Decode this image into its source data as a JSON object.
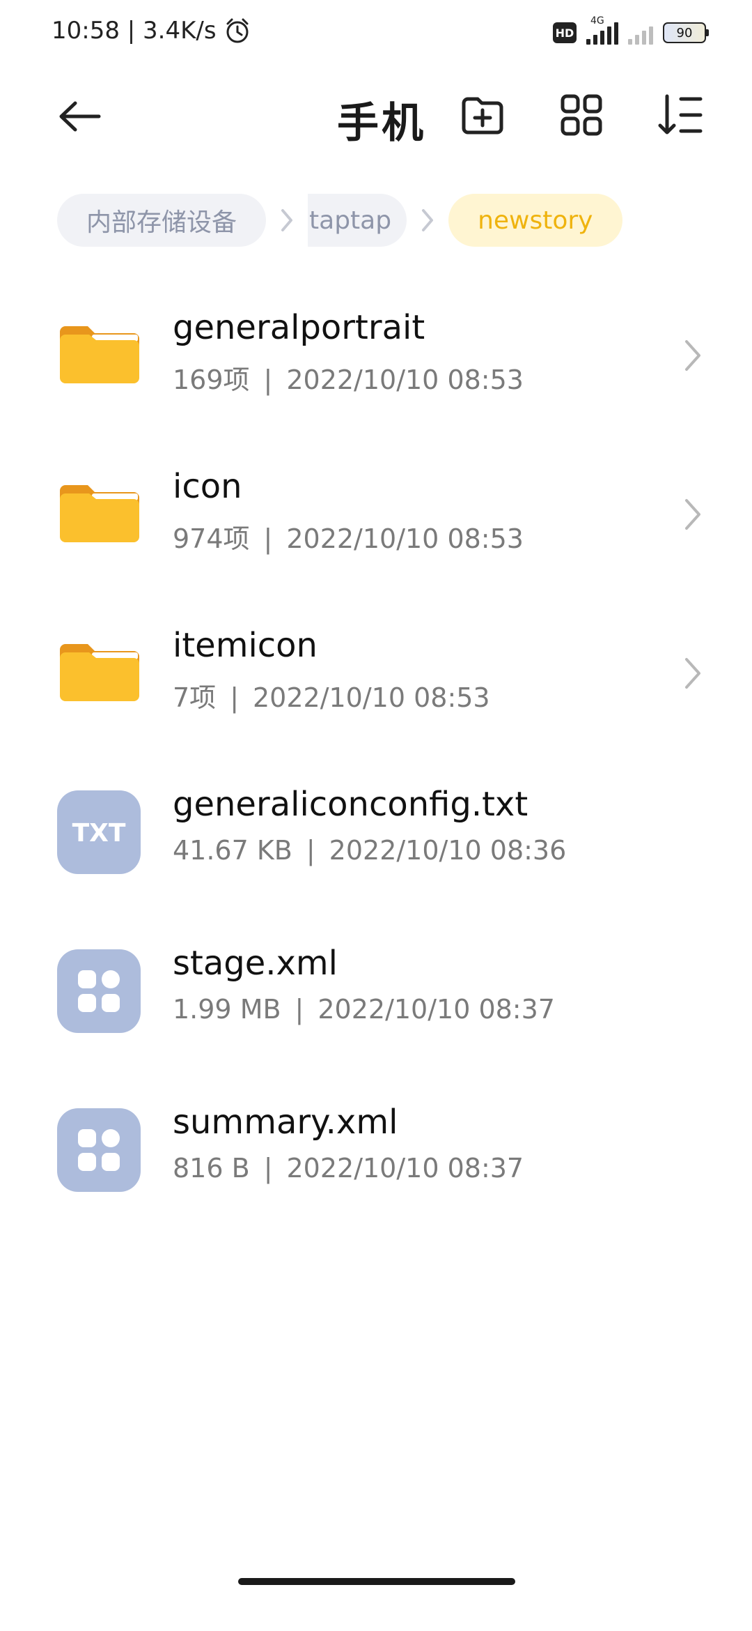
{
  "status_bar": {
    "time_speed": "10:58 | 3.4K/s",
    "hd_label": "HD",
    "network_label": "4G",
    "battery": "90"
  },
  "toolbar": {
    "title": "手机"
  },
  "breadcrumb": [
    {
      "label": "内部存储设备"
    },
    {
      "label": "taptap"
    },
    {
      "label": "newstory"
    }
  ],
  "files": [
    {
      "name": "generalportrait",
      "meta_left": "169项",
      "meta_right": "2022/10/10 08:53",
      "icon": "folder-icon"
    },
    {
      "name": "icon",
      "meta_left": "974项",
      "meta_right": "2022/10/10 08:53",
      "icon": "folder-icon"
    },
    {
      "name": "itemicon",
      "meta_left": "7项",
      "meta_right": "2022/10/10 08:53",
      "icon": "folder-icon"
    },
    {
      "name": "generaliconconfig.txt",
      "meta_left": "41.67 KB",
      "meta_right": "2022/10/10 08:36",
      "icon": "txt-file-icon",
      "icon_label": "TXT"
    },
    {
      "name": "stage.xml",
      "meta_left": "1.99 MB",
      "meta_right": "2022/10/10 08:37",
      "icon": "app-file-icon"
    },
    {
      "name": "summary.xml",
      "meta_left": "816 B",
      "meta_right": "2022/10/10 08:37",
      "icon": "app-file-icon"
    }
  ],
  "colors": {
    "folder": "#fbc02d",
    "file_icon_bg": "#adbcdc",
    "breadcrumb_active_bg": "#fff5d2",
    "breadcrumb_active_text": "#efb30e"
  }
}
